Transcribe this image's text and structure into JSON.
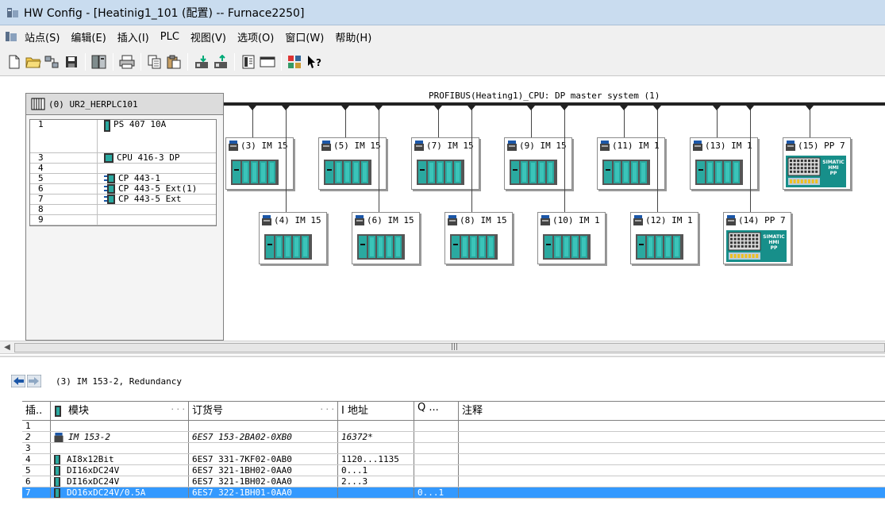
{
  "window": {
    "title": "HW Config - [Heatinig1_101 (配置) -- Furnace2250]"
  },
  "menu": [
    "站点(S)",
    "编辑(E)",
    "插入(I)",
    "PLC",
    "视图(V)",
    "选项(O)",
    "窗口(W)",
    "帮助(H)"
  ],
  "toolbar": [
    "new-icon",
    "open-icon",
    "network-icon",
    "save-icon",
    "compile-icon",
    "print-icon",
    "copy-icon",
    "paste-icon",
    "download-icon",
    "upload-icon",
    "catalog-icon",
    "window-icon",
    "netpro-icon",
    "help-icon"
  ],
  "rack": {
    "title": "(0) UR2_HERPLC101",
    "rows": [
      {
        "slot": "1",
        "module": "PS 407 10A",
        "icon": "ps-module-icon",
        "tall": true
      },
      {
        "slot": "3",
        "module": "CPU 416-3 DP",
        "icon": "cpu-module-icon"
      },
      {
        "slot": "4",
        "module": ""
      },
      {
        "slot": "5",
        "module": "CP 443-1",
        "icon": "cp-module-icon"
      },
      {
        "slot": "6",
        "module": "CP 443-5 Ext(1)",
        "icon": "cp-module-icon"
      },
      {
        "slot": "7",
        "module": "CP 443-5 Ext",
        "icon": "cp-module-icon"
      },
      {
        "slot": "8",
        "module": ""
      },
      {
        "slot": "9",
        "module": ""
      }
    ]
  },
  "bus": {
    "label": "PROFIBUS(Heating1)_CPU: DP master system (1)"
  },
  "slaves_top": [
    {
      "label": "(3) IM 15",
      "kind": "im"
    },
    {
      "label": "(5) IM 15",
      "kind": "im"
    },
    {
      "label": "(7) IM 15",
      "kind": "im"
    },
    {
      "label": "(9) IM 15",
      "kind": "im"
    },
    {
      "label": "(11) IM 1",
      "kind": "im"
    },
    {
      "label": "(13) IM 1",
      "kind": "im"
    },
    {
      "label": "(15) PP 7",
      "kind": "hmi"
    }
  ],
  "slaves_bottom": [
    {
      "label": "(4) IM 15",
      "kind": "im"
    },
    {
      "label": "(6) IM 15",
      "kind": "im"
    },
    {
      "label": "(8) IM 15",
      "kind": "im"
    },
    {
      "label": "(10) IM 1",
      "kind": "im"
    },
    {
      "label": "(12) IM 1",
      "kind": "im"
    },
    {
      "label": "(14) PP 7",
      "kind": "hmi"
    }
  ],
  "hmi_text": [
    "SIMATIC",
    "HMI",
    "PP"
  ],
  "detail": {
    "title": "(3)   IM 153-2, Redundancy",
    "headers": {
      "slot": "插..",
      "module": "模块",
      "order": "订货号",
      "iaddr": "I 地址",
      "qaddr": "Q ...",
      "comment": "注释"
    },
    "rows": [
      {
        "slot": "1",
        "module": "",
        "order": "",
        "i": "",
        "q": ""
      },
      {
        "slot": "2",
        "module": "IM 153-2",
        "order": "6ES7 153-2BA02-0XB0",
        "i": "16372*",
        "q": "",
        "italic": true,
        "icon": "im-module-icon"
      },
      {
        "slot": "3",
        "module": "",
        "order": "",
        "i": "",
        "q": ""
      },
      {
        "slot": "4",
        "module": "AI8x12Bit",
        "order": "6ES7 331-7KF02-0AB0",
        "i": "1120...1135",
        "q": "",
        "icon": "io-module-icon"
      },
      {
        "slot": "5",
        "module": "DI16xDC24V",
        "order": "6ES7 321-1BH02-0AA0",
        "i": "0...1",
        "q": "",
        "icon": "io-module-icon"
      },
      {
        "slot": "6",
        "module": "DI16xDC24V",
        "order": "6ES7 321-1BH02-0AA0",
        "i": "2...3",
        "q": "",
        "icon": "io-module-icon"
      },
      {
        "slot": "7",
        "module": "DO16xDC24V/0.5A",
        "order": "6ES7 322-1BH01-0AA0",
        "i": "",
        "q": "0...1",
        "icon": "io-module-icon",
        "selected": true
      }
    ]
  },
  "colors": {
    "titlebar": "#c9dcef",
    "selection": "#3399ff",
    "module_teal": "#2aa9a0",
    "hmi_teal": "#178f8a"
  }
}
